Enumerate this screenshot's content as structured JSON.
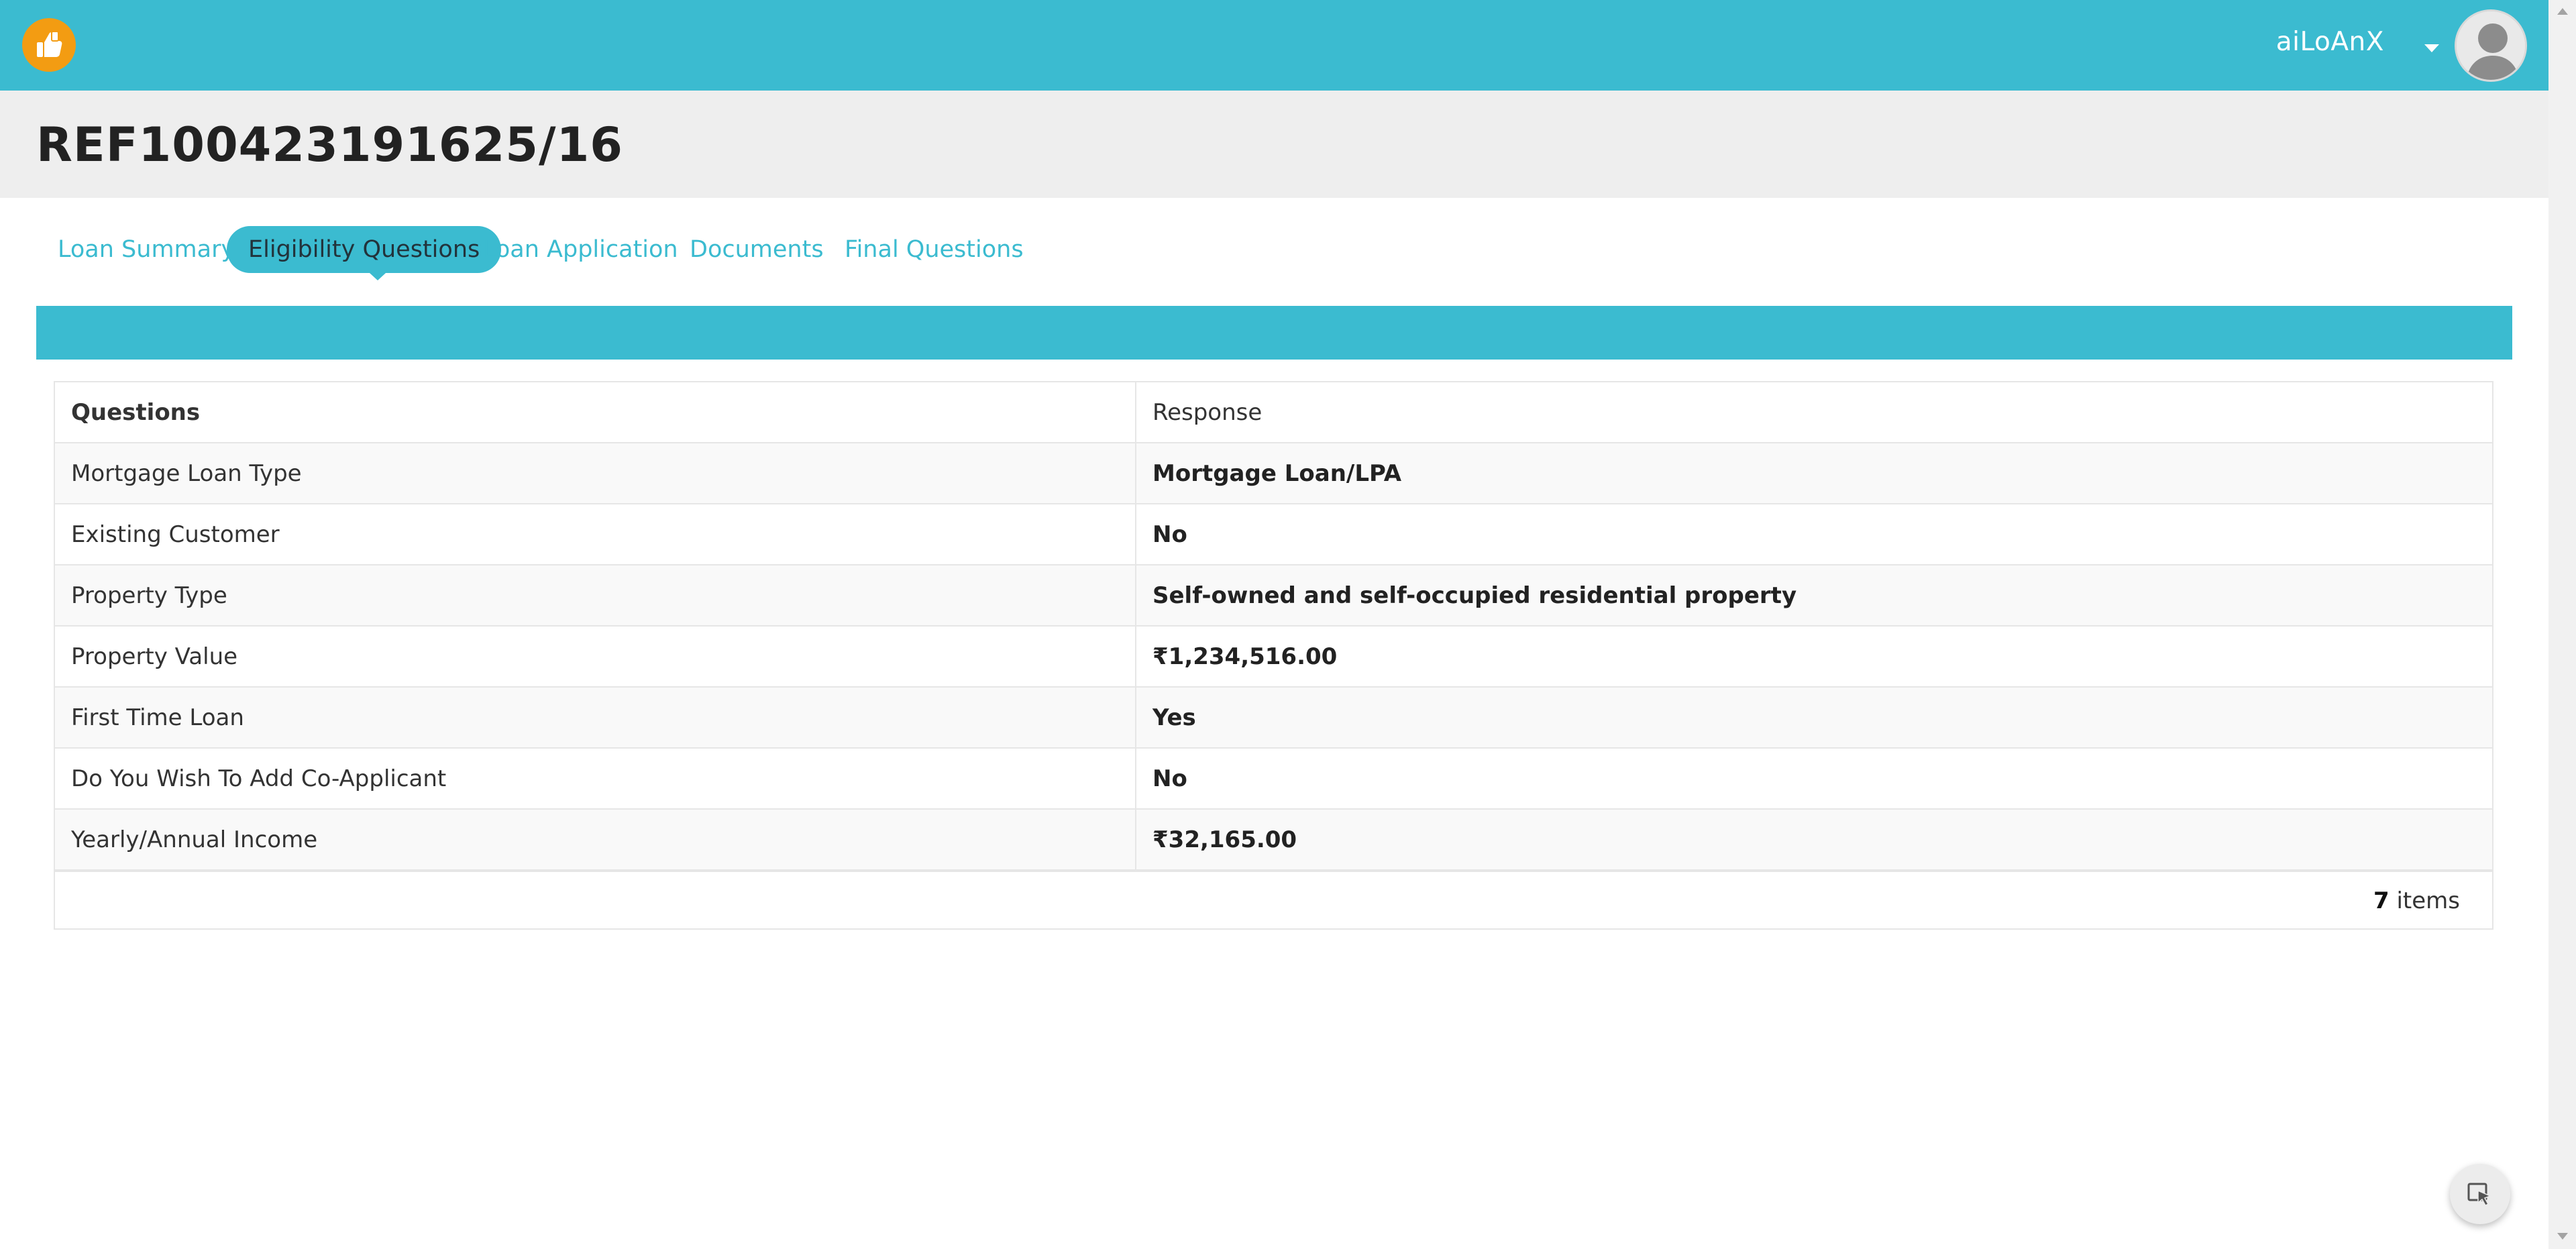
{
  "app": {
    "logo_icon": "thumbs-up-hand-icon",
    "accent_color": "#3bbbd0",
    "logo_color": "#f39c12"
  },
  "user": {
    "name": "aiLoAnX",
    "avatar_icon": "user-avatar-icon"
  },
  "page": {
    "title": "REF100423191625/16"
  },
  "tabs": [
    {
      "label": "Loan Summary",
      "active": false
    },
    {
      "label": "Eligibility Questions",
      "active": true
    },
    {
      "label": "Loan Application",
      "active": false
    },
    {
      "label": "Documents",
      "active": false
    },
    {
      "label": "Final Questions",
      "active": false
    }
  ],
  "table": {
    "headers": {
      "question": "Questions",
      "response": "Response"
    },
    "rows": [
      {
        "question": "Mortgage Loan Type",
        "response": "Mortgage Loan/LPA"
      },
      {
        "question": "Existing Customer",
        "response": "No"
      },
      {
        "question": "Property Type",
        "response": "Self-owned and self-occupied residential property"
      },
      {
        "question": "Property Value",
        "response": "₹1,234,516.00"
      },
      {
        "question": "First Time Loan",
        "response": "Yes"
      },
      {
        "question": "Do You Wish To Add Co-Applicant",
        "response": "No"
      },
      {
        "question": "Yearly/Annual Income",
        "response": "₹32,165.00"
      }
    ],
    "footer": {
      "count": "7",
      "count_label": "items"
    }
  },
  "floating_button": {
    "icon": "cursor-select-icon"
  }
}
